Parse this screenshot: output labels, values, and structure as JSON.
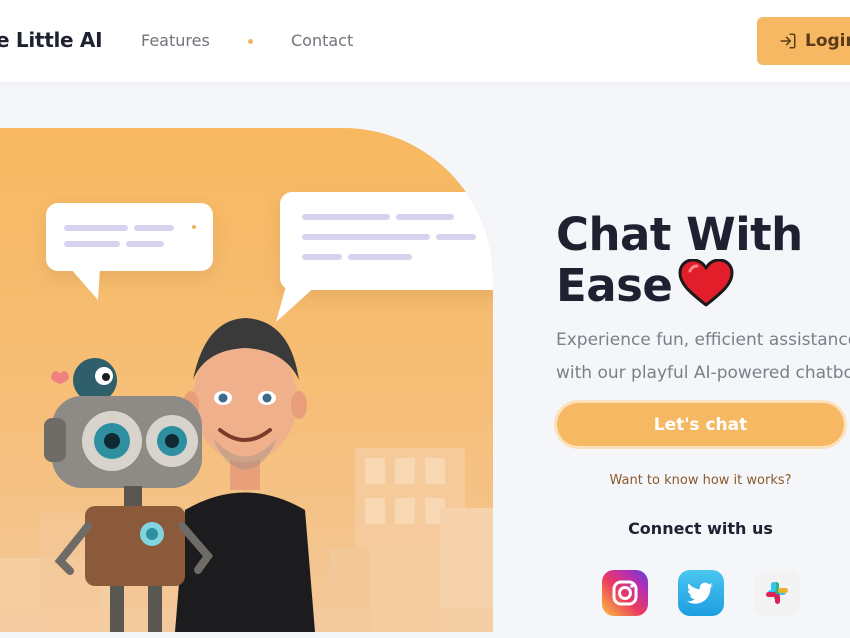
{
  "header": {
    "brand": "e Little AI",
    "nav": [
      {
        "label": "Features"
      },
      {
        "label": "Contact"
      }
    ],
    "login_label": "Login"
  },
  "hero": {
    "title_line1": "Chat With",
    "title_line2": "Ease",
    "subtitle_line1": "Experience fun, efficient assistance",
    "subtitle_line2": "with our playful AI-powered chatbot",
    "cta_label": "Let's chat",
    "how_link": "Want to know how it works?",
    "connect_label": "Connect with us"
  },
  "social": [
    {
      "name": "instagram-icon"
    },
    {
      "name": "twitter-icon"
    },
    {
      "name": "slack-icon"
    }
  ],
  "colors": {
    "accent": "#f7b863",
    "dark_text": "#1e2230",
    "muted_text": "#7c7f87",
    "link_brown": "#8a5a2b"
  }
}
